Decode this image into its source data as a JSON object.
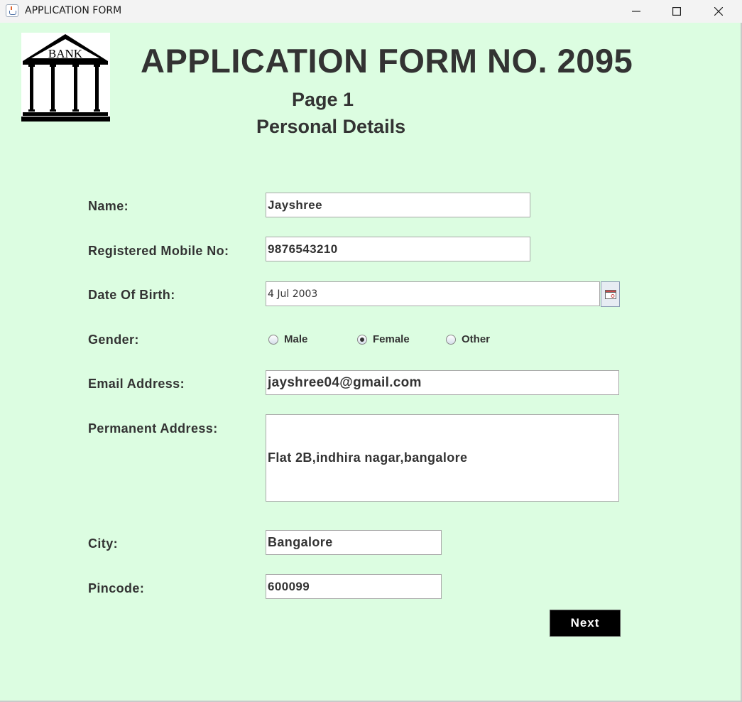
{
  "window": {
    "title": "APPLICATION FORM"
  },
  "logo": {
    "text": "BANK"
  },
  "header": {
    "title": "APPLICATION FORM NO. 2095",
    "page": "Page 1",
    "section": "Personal Details"
  },
  "form": {
    "name_label": "Name:",
    "name_value": "Jayshree",
    "mobile_label": "Registered Mobile No:",
    "mobile_value": "9876543210",
    "dob_label": "Date Of Birth:",
    "dob_value": "4 Jul 2003",
    "gender_label": "Gender:",
    "gender_options": [
      "Male",
      "Female",
      "Other"
    ],
    "gender_selected": "Female",
    "email_label": "Email Address:",
    "email_value": "jayshree04@gmail.com",
    "address_label": "Permanent Address:",
    "address_value": "Flat 2B,indhira nagar,bangalore",
    "city_label": "City:",
    "city_value": "Bangalore",
    "pincode_label": "Pincode:",
    "pincode_value": "600099",
    "next_label": "Next"
  },
  "colors": {
    "background": "#dcfde1",
    "button": "#000000",
    "text": "#333333"
  },
  "icons": {
    "calendar": "calendar-icon",
    "app": "java-app-icon"
  }
}
